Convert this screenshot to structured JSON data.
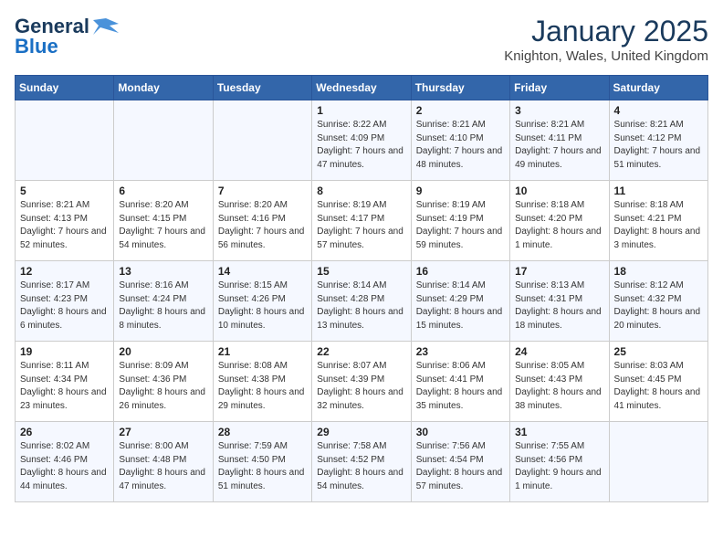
{
  "header": {
    "logo_line1": "General",
    "logo_line2": "Blue",
    "title": "January 2025",
    "subtitle": "Knighton, Wales, United Kingdom"
  },
  "days_of_week": [
    "Sunday",
    "Monday",
    "Tuesday",
    "Wednesday",
    "Thursday",
    "Friday",
    "Saturday"
  ],
  "weeks": [
    [
      {
        "day": "",
        "info": ""
      },
      {
        "day": "",
        "info": ""
      },
      {
        "day": "",
        "info": ""
      },
      {
        "day": "1",
        "info": "Sunrise: 8:22 AM\nSunset: 4:09 PM\nDaylight: 7 hours and 47 minutes."
      },
      {
        "day": "2",
        "info": "Sunrise: 8:21 AM\nSunset: 4:10 PM\nDaylight: 7 hours and 48 minutes."
      },
      {
        "day": "3",
        "info": "Sunrise: 8:21 AM\nSunset: 4:11 PM\nDaylight: 7 hours and 49 minutes."
      },
      {
        "day": "4",
        "info": "Sunrise: 8:21 AM\nSunset: 4:12 PM\nDaylight: 7 hours and 51 minutes."
      }
    ],
    [
      {
        "day": "5",
        "info": "Sunrise: 8:21 AM\nSunset: 4:13 PM\nDaylight: 7 hours and 52 minutes."
      },
      {
        "day": "6",
        "info": "Sunrise: 8:20 AM\nSunset: 4:15 PM\nDaylight: 7 hours and 54 minutes."
      },
      {
        "day": "7",
        "info": "Sunrise: 8:20 AM\nSunset: 4:16 PM\nDaylight: 7 hours and 56 minutes."
      },
      {
        "day": "8",
        "info": "Sunrise: 8:19 AM\nSunset: 4:17 PM\nDaylight: 7 hours and 57 minutes."
      },
      {
        "day": "9",
        "info": "Sunrise: 8:19 AM\nSunset: 4:19 PM\nDaylight: 7 hours and 59 minutes."
      },
      {
        "day": "10",
        "info": "Sunrise: 8:18 AM\nSunset: 4:20 PM\nDaylight: 8 hours and 1 minute."
      },
      {
        "day": "11",
        "info": "Sunrise: 8:18 AM\nSunset: 4:21 PM\nDaylight: 8 hours and 3 minutes."
      }
    ],
    [
      {
        "day": "12",
        "info": "Sunrise: 8:17 AM\nSunset: 4:23 PM\nDaylight: 8 hours and 6 minutes."
      },
      {
        "day": "13",
        "info": "Sunrise: 8:16 AM\nSunset: 4:24 PM\nDaylight: 8 hours and 8 minutes."
      },
      {
        "day": "14",
        "info": "Sunrise: 8:15 AM\nSunset: 4:26 PM\nDaylight: 8 hours and 10 minutes."
      },
      {
        "day": "15",
        "info": "Sunrise: 8:14 AM\nSunset: 4:28 PM\nDaylight: 8 hours and 13 minutes."
      },
      {
        "day": "16",
        "info": "Sunrise: 8:14 AM\nSunset: 4:29 PM\nDaylight: 8 hours and 15 minutes."
      },
      {
        "day": "17",
        "info": "Sunrise: 8:13 AM\nSunset: 4:31 PM\nDaylight: 8 hours and 18 minutes."
      },
      {
        "day": "18",
        "info": "Sunrise: 8:12 AM\nSunset: 4:32 PM\nDaylight: 8 hours and 20 minutes."
      }
    ],
    [
      {
        "day": "19",
        "info": "Sunrise: 8:11 AM\nSunset: 4:34 PM\nDaylight: 8 hours and 23 minutes."
      },
      {
        "day": "20",
        "info": "Sunrise: 8:09 AM\nSunset: 4:36 PM\nDaylight: 8 hours and 26 minutes."
      },
      {
        "day": "21",
        "info": "Sunrise: 8:08 AM\nSunset: 4:38 PM\nDaylight: 8 hours and 29 minutes."
      },
      {
        "day": "22",
        "info": "Sunrise: 8:07 AM\nSunset: 4:39 PM\nDaylight: 8 hours and 32 minutes."
      },
      {
        "day": "23",
        "info": "Sunrise: 8:06 AM\nSunset: 4:41 PM\nDaylight: 8 hours and 35 minutes."
      },
      {
        "day": "24",
        "info": "Sunrise: 8:05 AM\nSunset: 4:43 PM\nDaylight: 8 hours and 38 minutes."
      },
      {
        "day": "25",
        "info": "Sunrise: 8:03 AM\nSunset: 4:45 PM\nDaylight: 8 hours and 41 minutes."
      }
    ],
    [
      {
        "day": "26",
        "info": "Sunrise: 8:02 AM\nSunset: 4:46 PM\nDaylight: 8 hours and 44 minutes."
      },
      {
        "day": "27",
        "info": "Sunrise: 8:00 AM\nSunset: 4:48 PM\nDaylight: 8 hours and 47 minutes."
      },
      {
        "day": "28",
        "info": "Sunrise: 7:59 AM\nSunset: 4:50 PM\nDaylight: 8 hours and 51 minutes."
      },
      {
        "day": "29",
        "info": "Sunrise: 7:58 AM\nSunset: 4:52 PM\nDaylight: 8 hours and 54 minutes."
      },
      {
        "day": "30",
        "info": "Sunrise: 7:56 AM\nSunset: 4:54 PM\nDaylight: 8 hours and 57 minutes."
      },
      {
        "day": "31",
        "info": "Sunrise: 7:55 AM\nSunset: 4:56 PM\nDaylight: 9 hours and 1 minute."
      },
      {
        "day": "",
        "info": ""
      }
    ]
  ]
}
